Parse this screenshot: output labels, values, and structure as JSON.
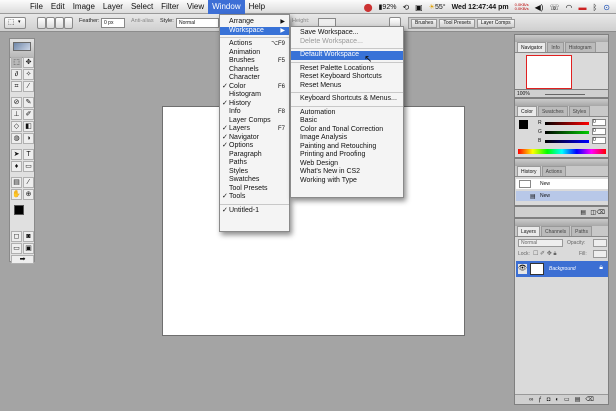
{
  "menubar": {
    "items": [
      "File",
      "Edit",
      "Image",
      "Layer",
      "Select",
      "Filter",
      "View",
      "Window",
      "Help"
    ],
    "active": "Window",
    "battery": "92%",
    "temperature": "55°",
    "clock": "Wed 12:47:44 pm",
    "net_up": "0.0KB/s",
    "net_down": "0.0KB/s"
  },
  "options": {
    "feather_label": "Feather:",
    "feather_value": "0 px",
    "antialias_label": "Anti-alias",
    "style_label": "Style:",
    "style_value": "Normal",
    "height_label": "Height:",
    "well_tabs": [
      "Brushes",
      "Tool Presets",
      "Layer Comps"
    ]
  },
  "window_menu": {
    "items": [
      {
        "label": "Arrange",
        "submenu": true
      },
      {
        "label": "Workspace",
        "submenu": true,
        "highlighted": true
      },
      {
        "sep": true
      },
      {
        "label": "Actions",
        "shortcut": "⌥F9"
      },
      {
        "label": "Animation"
      },
      {
        "label": "Brushes",
        "shortcut": "F5"
      },
      {
        "label": "Channels"
      },
      {
        "label": "Character"
      },
      {
        "label": "Color",
        "shortcut": "F6",
        "checked": true
      },
      {
        "label": "Histogram"
      },
      {
        "label": "History",
        "checked": true
      },
      {
        "label": "Info",
        "shortcut": "F8"
      },
      {
        "label": "Layer Comps"
      },
      {
        "label": "Layers",
        "shortcut": "F7",
        "checked": true
      },
      {
        "label": "Navigator",
        "checked": true
      },
      {
        "label": "Options",
        "checked": true
      },
      {
        "label": "Paragraph"
      },
      {
        "label": "Paths"
      },
      {
        "label": "Styles"
      },
      {
        "label": "Swatches"
      },
      {
        "label": "Tool Presets"
      },
      {
        "label": "Tools",
        "checked": true
      },
      {
        "sep": true
      },
      {
        "label": "Untitled-1",
        "checked": true
      }
    ]
  },
  "workspace_menu": {
    "items": [
      {
        "label": "Save Workspace..."
      },
      {
        "label": "Delete Workspace...",
        "disabled": true
      },
      {
        "sep": true
      },
      {
        "label": "Default Workspace",
        "highlighted": true
      },
      {
        "sep": true
      },
      {
        "label": "Reset Palette Locations"
      },
      {
        "label": "Reset Keyboard Shortcuts"
      },
      {
        "label": "Reset Menus"
      },
      {
        "sep": true
      },
      {
        "label": "Keyboard Shortcuts & Menus..."
      },
      {
        "sep": true
      },
      {
        "label": "Automation"
      },
      {
        "label": "Basic"
      },
      {
        "label": "Color and Tonal Correction"
      },
      {
        "label": "Image Analysis"
      },
      {
        "label": "Painting and Retouching"
      },
      {
        "label": "Printing and Proofing"
      },
      {
        "label": "Web Design"
      },
      {
        "label": "What's New in CS2"
      },
      {
        "label": "Working with Type"
      }
    ]
  },
  "panels": {
    "navigator": {
      "tabs": [
        "Navigator",
        "Info",
        "Histogram"
      ],
      "zoom": "100%"
    },
    "color": {
      "tabs": [
        "Color",
        "Swatches",
        "Styles"
      ],
      "channels": [
        "R",
        "G",
        "B"
      ],
      "values": [
        "0",
        "0",
        "0"
      ]
    },
    "history": {
      "tabs": [
        "History",
        "Actions"
      ],
      "rows": [
        "New",
        "New"
      ]
    },
    "layers": {
      "tabs": [
        "Layers",
        "Channels",
        "Paths"
      ],
      "mode": "Normal",
      "opacity_label": "Opacity:",
      "lock_label": "Lock:",
      "fill_label": "Fill:",
      "layer_name": "Background"
    }
  }
}
